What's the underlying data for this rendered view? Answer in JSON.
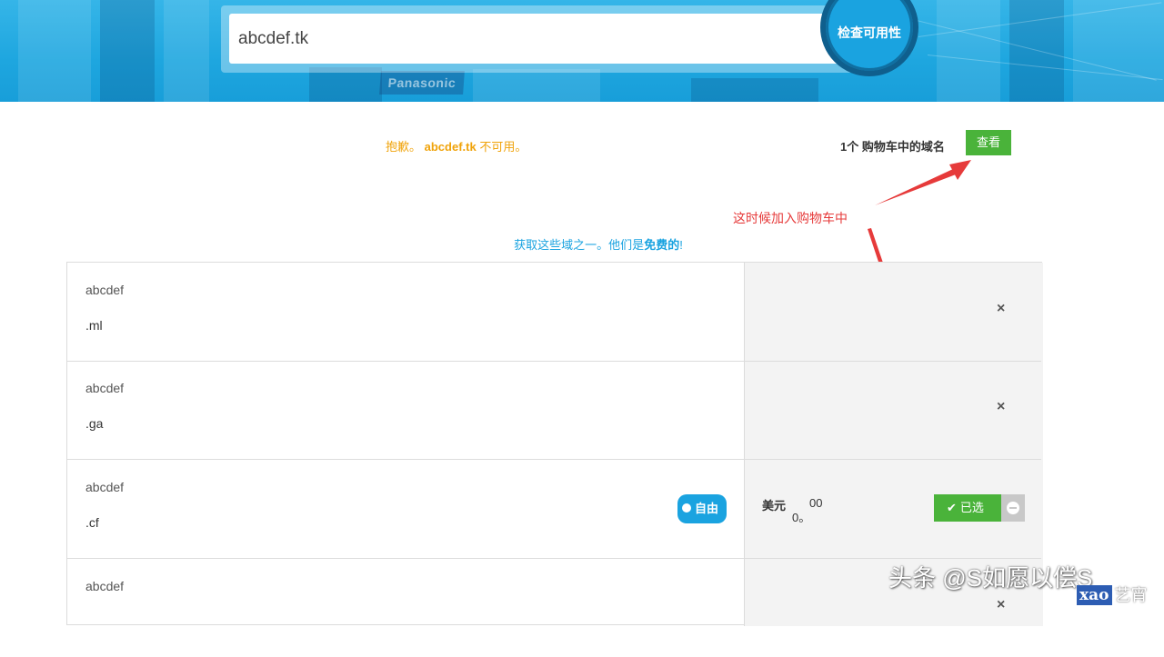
{
  "search": {
    "value": "abcdef.tk",
    "button_label": "检查可用性"
  },
  "hero": {
    "background_sign": "Panasonic"
  },
  "status": {
    "sorry_prefix": "抱歉。",
    "domain": "abcdef.tk",
    "sorry_suffix": "不可用。"
  },
  "cart": {
    "count_text": "1个 购物车中的域名",
    "view_label": "查看"
  },
  "annotation": "这时候加入购物车中",
  "free_message": {
    "prefix": "获取这些域之一。他们是",
    "bold": "免费的",
    "suffix": "!"
  },
  "domains": [
    {
      "name": "abcdef",
      "tld": ".ml",
      "remove_icon": "×"
    },
    {
      "name": "abcdef",
      "tld": ".ga",
      "remove_icon": "×"
    },
    {
      "name": "abcdef",
      "tld": ".cf",
      "badge": "自由",
      "price_currency": "美元",
      "price_int": "0。",
      "price_dec": "00",
      "selected_label": "已选"
    },
    {
      "name": "abcdef",
      "tld": "",
      "remove_icon": "×"
    }
  ],
  "watermark": {
    "line1": "头条 @S如愿以偿S",
    "tag": "xao",
    "line2": "艺宵"
  },
  "colors": {
    "accent_blue": "#1aa3e0",
    "green": "#4ab33a",
    "warning": "#f0a30a",
    "annotation_red": "#e63a3a"
  }
}
